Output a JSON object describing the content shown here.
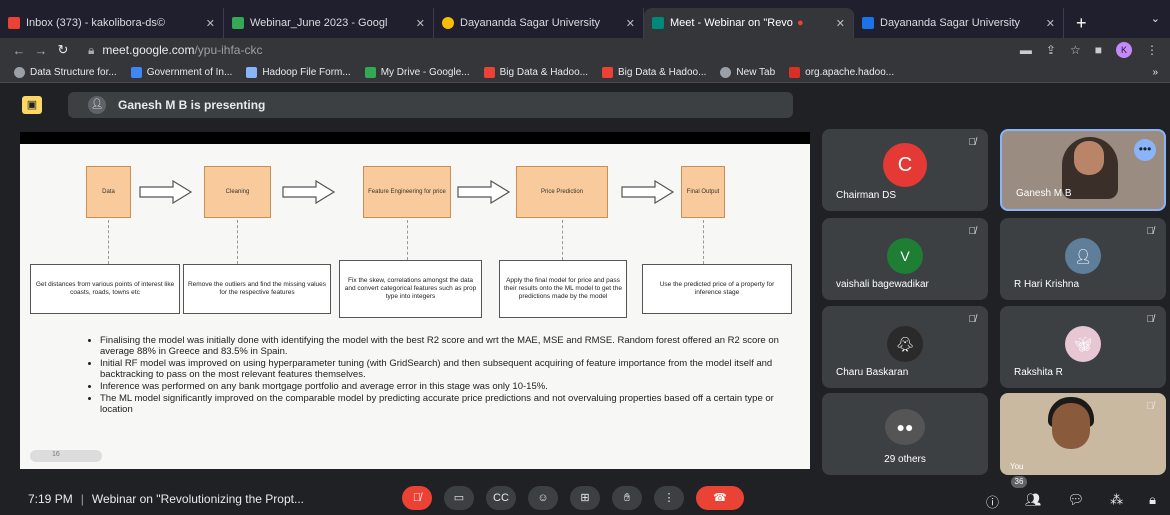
{
  "tabs": [
    {
      "label": "Inbox (373) - kakolibora-ds©",
      "color": "#ea4335"
    },
    {
      "label": "Webinar_June 2023 - Googl",
      "color": "#34a853"
    },
    {
      "label": "Dayananda Sagar University",
      "color": "#fbbc04"
    },
    {
      "label": "Meet - Webinar on \"Revo",
      "color": "#00897b"
    },
    {
      "label": "Dayananda Sagar University",
      "color": "#1a73e8"
    }
  ],
  "url": {
    "host": "meet.google.com",
    "path": "/ypu-ihfa-ckc"
  },
  "profile_initial": "K",
  "bookmarks": [
    {
      "label": "Data Structure for...",
      "color": "#9aa0a6"
    },
    {
      "label": "Government of In...",
      "color": "#4285f4"
    },
    {
      "label": "Hadoop File Form...",
      "color": "#8ab4f8"
    },
    {
      "label": "My Drive - Google...",
      "color": "#34a853"
    },
    {
      "label": "Big Data & Hadoo...",
      "color": "#ea4335"
    },
    {
      "label": "Big Data & Hadoo...",
      "color": "#ea4335"
    },
    {
      "label": "New Tab",
      "color": "#9aa0a6"
    },
    {
      "label": "org.apache.hadoo...",
      "color": "#d93025"
    }
  ],
  "presenting": {
    "text": "Ganesh M B is presenting"
  },
  "slide": {
    "steps": [
      {
        "title": "Data",
        "desc": "Get distances from various points of interest like coasts, roads, towns etc"
      },
      {
        "title": "Cleaning",
        "desc": "Remove the outliers and find the missing values for the respective features"
      },
      {
        "title": "Feature Engineering for price",
        "desc": "Fix the skew, correlations amongst the data and convert categorical features such as prop type into integers"
      },
      {
        "title": "Price Prediction",
        "desc": "Apply the final model for price and pass their results onto the ML model to get the predictions made by the model"
      },
      {
        "title": "Final Output",
        "desc": "Use the predicted price of a property for inference stage"
      }
    ],
    "bullets": [
      "Finalising the model was initially done with identifying the model with the best R2 score and wrt the MAE, MSE and RMSE. Random forest offered an R2 score on average 88% in Greece and 83.5% in Spain.",
      "Initial RF model was improved on using hyperparameter tuning (with GridSearch) and then subsequent acquiring of feature importance from the model itself and backtracking to pass on the most relevant features themselves.",
      "Inference was performed on any bank mortgage portfolio and average error in this stage was only 10-15%.",
      "The ML model significantly improved on the comparable model by predicting accurate price predictions and not overvaluing properties based off a certain type or location"
    ],
    "page": "16"
  },
  "participants": [
    {
      "name": "Chairman DS",
      "initial": "C",
      "color": "#e53935"
    },
    {
      "name": "Ganesh M B"
    },
    {
      "name": "vaishali bagewadikar",
      "initial": "V",
      "color": "#1e7e34"
    },
    {
      "name": "R Hari Krishna"
    },
    {
      "name": "Charu Baskaran"
    },
    {
      "name": "Rakshita R"
    },
    {
      "name": "29 others"
    },
    {
      "name": "You"
    }
  ],
  "participant_count": "36",
  "meeting": {
    "time": "7:19 PM",
    "title": "Webinar on \"Revolutionizing the Propt..."
  }
}
